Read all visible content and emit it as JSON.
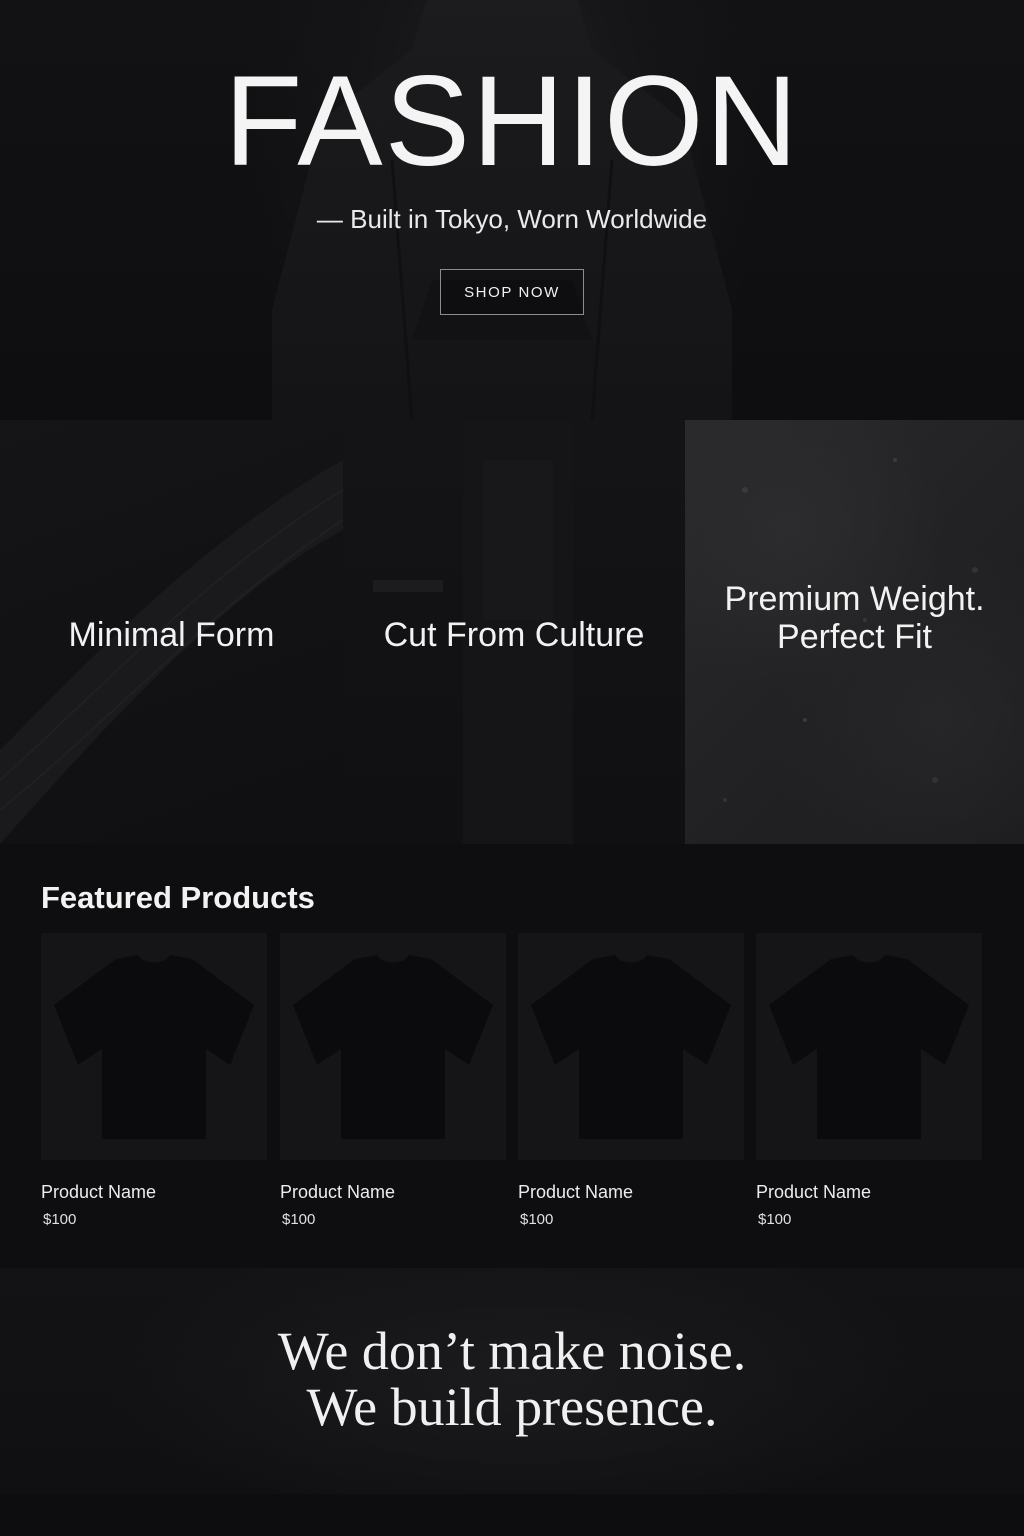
{
  "hero": {
    "title": "FASHION",
    "subtitle": "— Built in Tokyo, Worn Worldwide",
    "cta_label": "SHOP NOW"
  },
  "features": [
    {
      "label": "Minimal Form"
    },
    {
      "label": "Cut From Culture"
    },
    {
      "label_line1": "Premium Weight.",
      "label_line2": "Perfect Fit"
    }
  ],
  "featured": {
    "title": "Featured Products",
    "products": [
      {
        "name": "Product Name",
        "price": "$100",
        "icon": "tshirt-icon"
      },
      {
        "name": "Product Name",
        "price": "$100",
        "icon": "tshirt-icon"
      },
      {
        "name": "Product Name",
        "price": "$100",
        "icon": "tshirt-icon"
      },
      {
        "name": "Product Name",
        "price": "$100",
        "icon": "tshirt-icon"
      }
    ]
  },
  "tagline": {
    "line1": "We don’t make noise.",
    "line2": "We build presence."
  },
  "colors": {
    "background": "#0d0d0f",
    "text": "#f2f2f2",
    "button_border": "#8d8d8f"
  }
}
